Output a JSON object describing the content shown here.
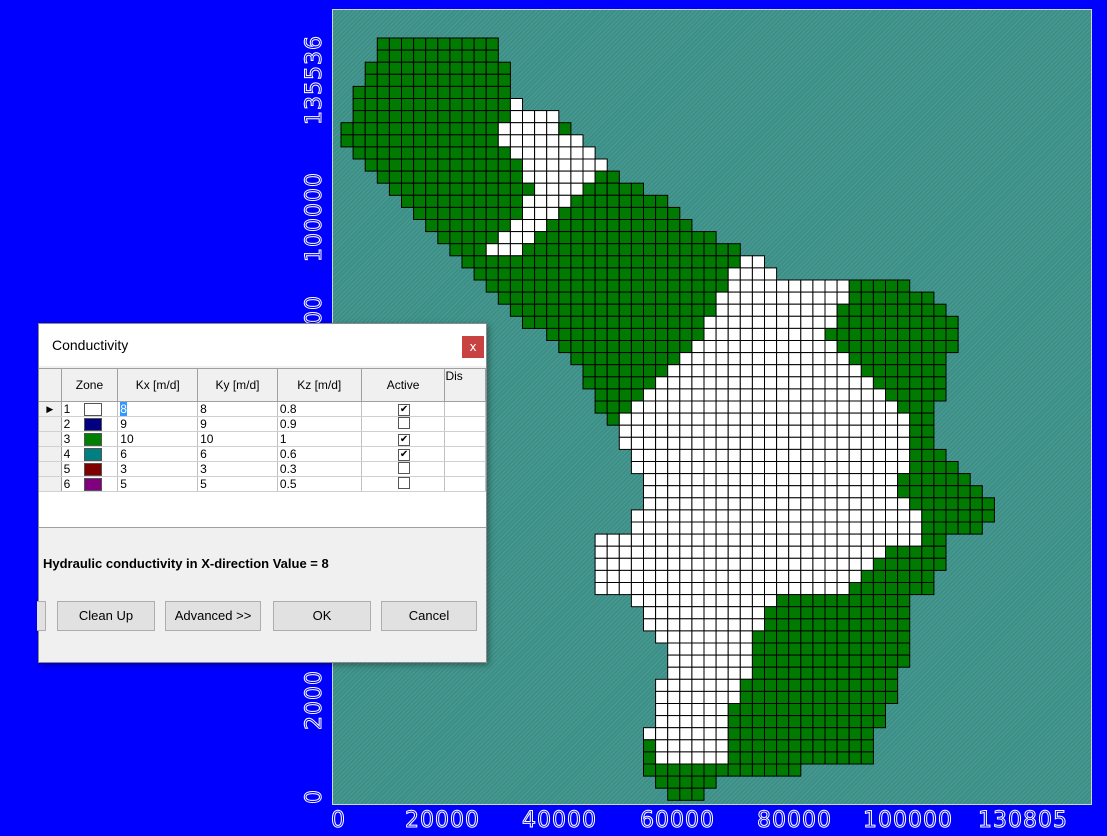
{
  "plot": {
    "y_ticks": [
      "135536",
      "100000",
      "00",
      "2000",
      "0"
    ],
    "x_ticks": [
      "0",
      "20000",
      "40000",
      "60000",
      "80000",
      "100000",
      "130805"
    ],
    "colors": {
      "background": "#0000ff",
      "inactive": "#3a8f86",
      "zone1": "#ffffff",
      "zone3": "#007a00"
    }
  },
  "dialog": {
    "title": "Conductivity",
    "close_icon": "close-icon",
    "columns": [
      "Zone",
      "Kx [m/d]",
      "Ky [m/d]",
      "Kz [m/d]",
      "Active",
      "Dis"
    ],
    "rows": [
      {
        "zone": "1",
        "color": "#ffffff",
        "kx": "8",
        "ky": "8",
        "kz": "0.8",
        "active": true
      },
      {
        "zone": "2",
        "color": "#000080",
        "kx": "9",
        "ky": "9",
        "kz": "0.9",
        "active": false
      },
      {
        "zone": "3",
        "color": "#008000",
        "kx": "10",
        "ky": "10",
        "kz": "1",
        "active": true
      },
      {
        "zone": "4",
        "color": "#008080",
        "kx": "6",
        "ky": "6",
        "kz": "0.6",
        "active": true
      },
      {
        "zone": "5",
        "color": "#800000",
        "kx": "3",
        "ky": "3",
        "kz": "0.3",
        "active": false
      },
      {
        "zone": "6",
        "color": "#800080",
        "kx": "5",
        "ky": "5",
        "kz": "0.5",
        "active": false
      }
    ],
    "status": "Hydraulic conductivity in X-direction Value = 8",
    "buttons": {
      "cleanup": "Clean Up",
      "advanced": "Advanced >>",
      "ok": "OK",
      "cancel": "Cancel"
    }
  }
}
